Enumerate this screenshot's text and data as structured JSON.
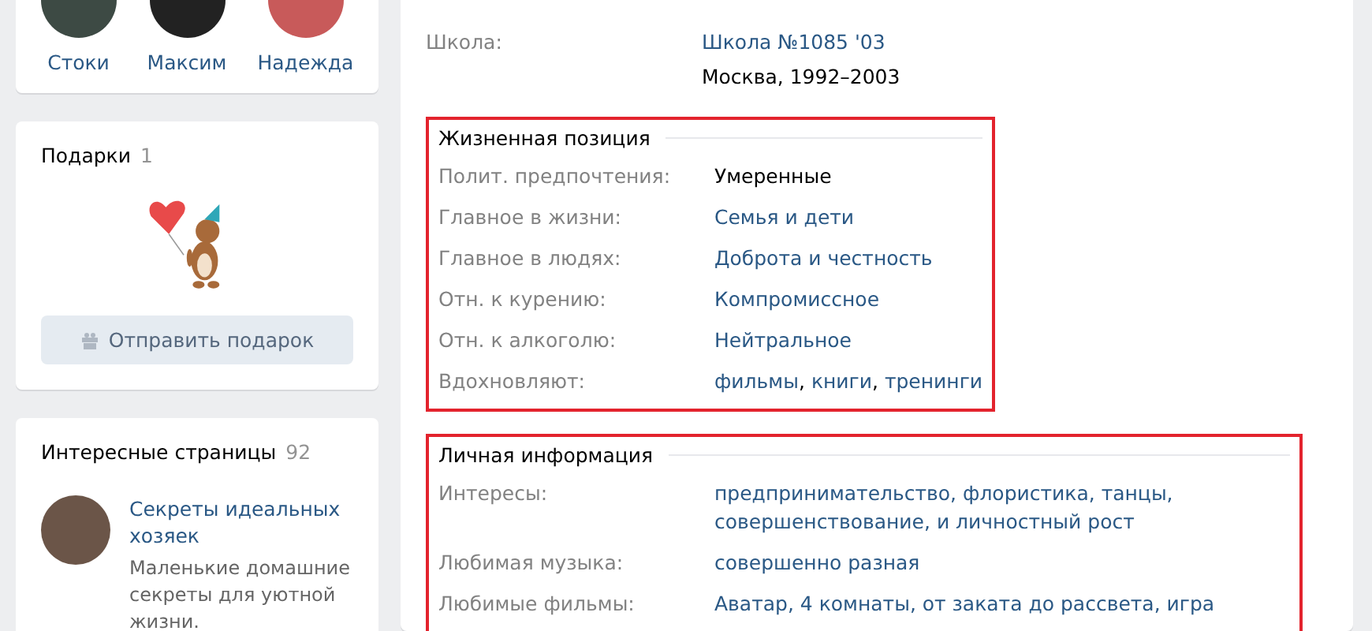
{
  "friends": [
    {
      "name": "Стоки"
    },
    {
      "name": "Максим"
    },
    {
      "name": "Надежда"
    }
  ],
  "gifts": {
    "title": "Подарки",
    "count": "1",
    "button": "Отправить подарок"
  },
  "pages": {
    "title": "Интересные страницы",
    "count": "92",
    "items": [
      {
        "name": "Секреты идеальных хозяек",
        "description": "Маленькие домашние секреты для уютной жизни."
      }
    ]
  },
  "education": [
    {
      "label": "Школа:",
      "values": [
        {
          "kind": "link",
          "text": "Школа №1085 '03"
        },
        {
          "kind": "text",
          "text": "Москва, 1992–2003"
        }
      ]
    }
  ],
  "sections": [
    {
      "title": "Жизненная позиция",
      "highlighted": true,
      "rows": [
        {
          "label": "Полит. предпочтения:",
          "kind": "text",
          "value": "Умеренные"
        },
        {
          "label": "Главное в жизни:",
          "kind": "link",
          "value": "Семья и дети"
        },
        {
          "label": "Главное в людях:",
          "kind": "link",
          "value": "Доброта и честность"
        },
        {
          "label": "Отн. к курению:",
          "kind": "link",
          "value": "Компромиссное"
        },
        {
          "label": "Отн. к алкоголю:",
          "kind": "link",
          "value": "Нейтральное"
        },
        {
          "label": "Вдохновляют:",
          "kind": "links",
          "separator": ",",
          "values": [
            "фильмы",
            "книги",
            "тренинги"
          ]
        }
      ]
    },
    {
      "title": "Личная информация",
      "highlighted": true,
      "rows": [
        {
          "label": "Интересы:",
          "kind": "link",
          "value": "предпринимательство, флористика, танцы, совершенствование, и личностный рост"
        },
        {
          "label": "Любимая музыка:",
          "kind": "link",
          "value": "совершенно разная"
        },
        {
          "label": "Любимые фильмы:",
          "kind": "link",
          "value": "Аватар, 4 комнаты, от заката до рассвета, игра"
        }
      ]
    }
  ]
}
